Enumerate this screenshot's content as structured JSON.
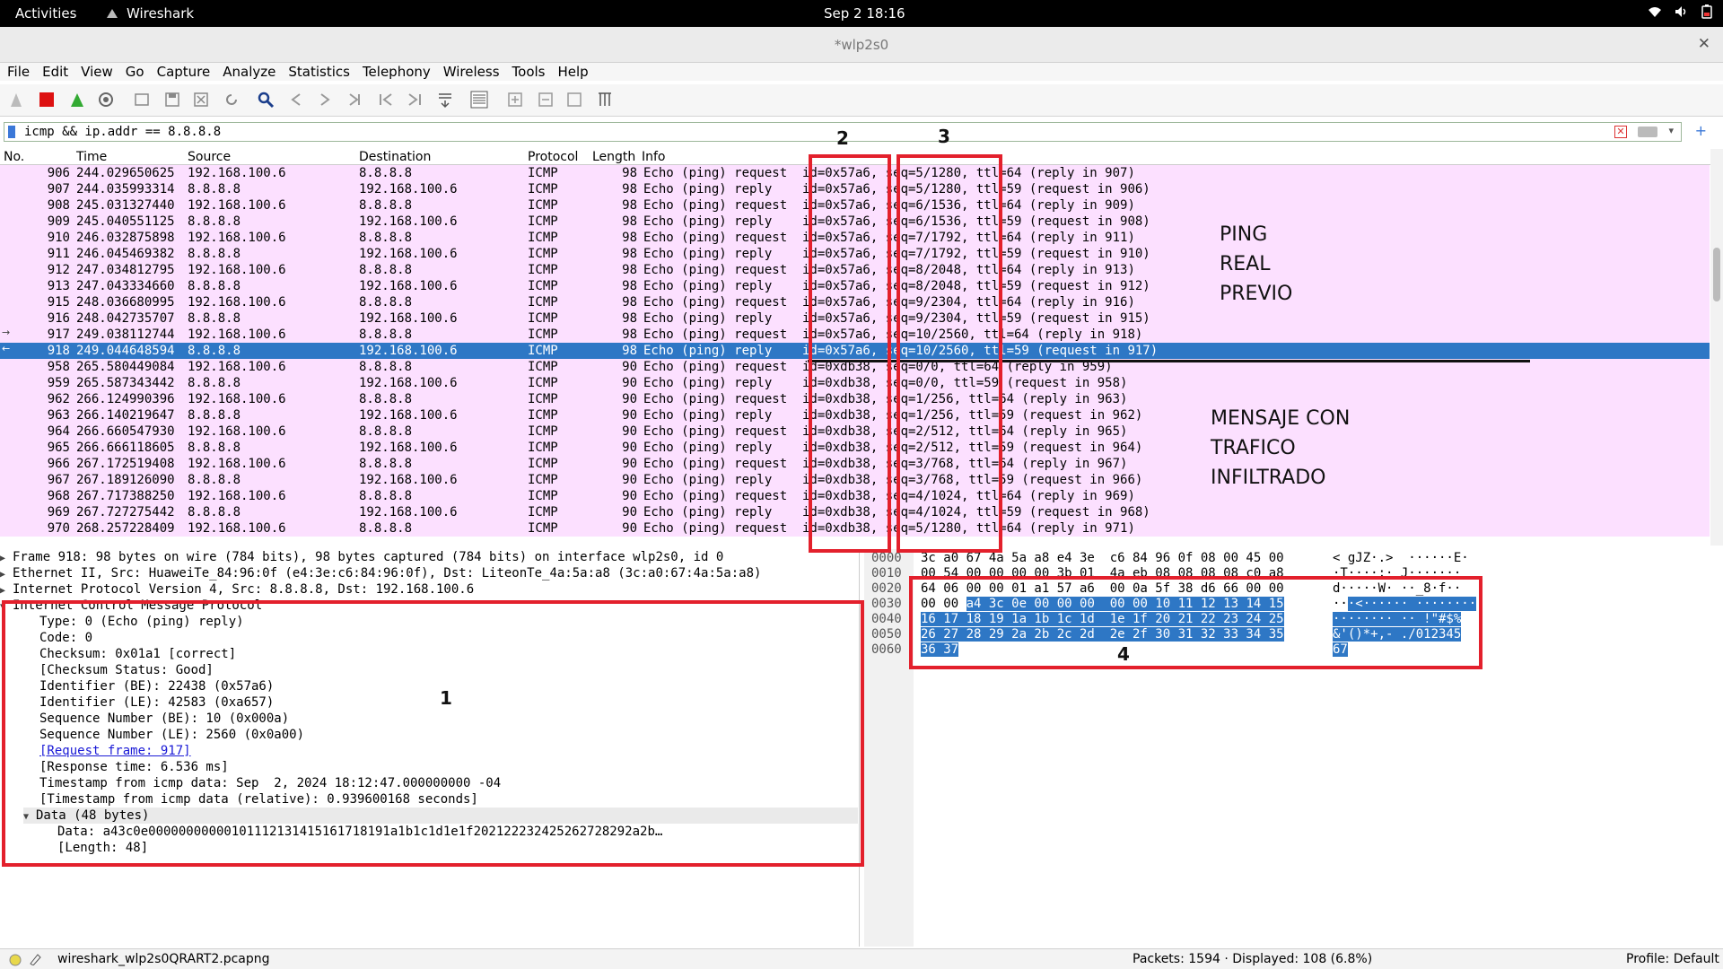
{
  "topbar": {
    "activities": "Activities",
    "app": "Wireshark",
    "clock": "Sep 2  18:16"
  },
  "window": {
    "title": "*wlp2s0"
  },
  "menu": [
    "File",
    "Edit",
    "View",
    "Go",
    "Capture",
    "Analyze",
    "Statistics",
    "Telephony",
    "Wireless",
    "Tools",
    "Help"
  ],
  "filter": {
    "text": "icmp && ip.addr == 8.8.8.8"
  },
  "packet_list": {
    "columns": {
      "no": "No.",
      "time": "Time",
      "source": "Source",
      "destination": "Destination",
      "protocol": "Protocol",
      "length": "Length",
      "info": "Info"
    },
    "rows": [
      {
        "no": "906",
        "time": "244.029650625",
        "src": "192.168.100.6",
        "dst": "8.8.8.8",
        "proto": "ICMP",
        "len": "98",
        "info": "Echo (ping) request  id=0x57a6, seq=5/1280, ttl=64 (reply in 907)"
      },
      {
        "no": "907",
        "time": "244.035993314",
        "src": "8.8.8.8",
        "dst": "192.168.100.6",
        "proto": "ICMP",
        "len": "98",
        "info": "Echo (ping) reply    id=0x57a6, seq=5/1280, ttl=59 (request in 906)"
      },
      {
        "no": "908",
        "time": "245.031327440",
        "src": "192.168.100.6",
        "dst": "8.8.8.8",
        "proto": "ICMP",
        "len": "98",
        "info": "Echo (ping) request  id=0x57a6, seq=6/1536, ttl=64 (reply in 909)"
      },
      {
        "no": "909",
        "time": "245.040551125",
        "src": "8.8.8.8",
        "dst": "192.168.100.6",
        "proto": "ICMP",
        "len": "98",
        "info": "Echo (ping) reply    id=0x57a6, seq=6/1536, ttl=59 (request in 908)"
      },
      {
        "no": "910",
        "time": "246.032875898",
        "src": "192.168.100.6",
        "dst": "8.8.8.8",
        "proto": "ICMP",
        "len": "98",
        "info": "Echo (ping) request  id=0x57a6, seq=7/1792, ttl=64 (reply in 911)"
      },
      {
        "no": "911",
        "time": "246.045469382",
        "src": "8.8.8.8",
        "dst": "192.168.100.6",
        "proto": "ICMP",
        "len": "98",
        "info": "Echo (ping) reply    id=0x57a6, seq=7/1792, ttl=59 (request in 910)"
      },
      {
        "no": "912",
        "time": "247.034812795",
        "src": "192.168.100.6",
        "dst": "8.8.8.8",
        "proto": "ICMP",
        "len": "98",
        "info": "Echo (ping) request  id=0x57a6, seq=8/2048, ttl=64 (reply in 913)"
      },
      {
        "no": "913",
        "time": "247.043334660",
        "src": "8.8.8.8",
        "dst": "192.168.100.6",
        "proto": "ICMP",
        "len": "98",
        "info": "Echo (ping) reply    id=0x57a6, seq=8/2048, ttl=59 (request in 912)"
      },
      {
        "no": "915",
        "time": "248.036680995",
        "src": "192.168.100.6",
        "dst": "8.8.8.8",
        "proto": "ICMP",
        "len": "98",
        "info": "Echo (ping) request  id=0x57a6, seq=9/2304, ttl=64 (reply in 916)"
      },
      {
        "no": "916",
        "time": "248.042735707",
        "src": "8.8.8.8",
        "dst": "192.168.100.6",
        "proto": "ICMP",
        "len": "98",
        "info": "Echo (ping) reply    id=0x57a6, seq=9/2304, ttl=59 (request in 915)"
      },
      {
        "no": "917",
        "time": "249.038112744",
        "src": "192.168.100.6",
        "dst": "8.8.8.8",
        "proto": "ICMP",
        "len": "98",
        "info": "Echo (ping) request  id=0x57a6, seq=10/2560, ttl=64 (reply in 918)"
      },
      {
        "no": "918",
        "time": "249.044648594",
        "src": "8.8.8.8",
        "dst": "192.168.100.6",
        "proto": "ICMP",
        "len": "98",
        "info": "Echo (ping) reply    id=0x57a6, seq=10/2560, ttl=59 (request in 917)"
      },
      {
        "no": "958",
        "time": "265.580449084",
        "src": "192.168.100.6",
        "dst": "8.8.8.8",
        "proto": "ICMP",
        "len": "90",
        "info": "Echo (ping) request  id=0xdb38, seq=0/0, ttl=64 (reply in 959)"
      },
      {
        "no": "959",
        "time": "265.587343442",
        "src": "8.8.8.8",
        "dst": "192.168.100.6",
        "proto": "ICMP",
        "len": "90",
        "info": "Echo (ping) reply    id=0xdb38, seq=0/0, ttl=59 (request in 958)"
      },
      {
        "no": "962",
        "time": "266.124990396",
        "src": "192.168.100.6",
        "dst": "8.8.8.8",
        "proto": "ICMP",
        "len": "90",
        "info": "Echo (ping) request  id=0xdb38, seq=1/256, ttl=64 (reply in 963)"
      },
      {
        "no": "963",
        "time": "266.140219647",
        "src": "8.8.8.8",
        "dst": "192.168.100.6",
        "proto": "ICMP",
        "len": "90",
        "info": "Echo (ping) reply    id=0xdb38, seq=1/256, ttl=59 (request in 962)"
      },
      {
        "no": "964",
        "time": "266.660547930",
        "src": "192.168.100.6",
        "dst": "8.8.8.8",
        "proto": "ICMP",
        "len": "90",
        "info": "Echo (ping) request  id=0xdb38, seq=2/512, ttl=64 (reply in 965)"
      },
      {
        "no": "965",
        "time": "266.666118605",
        "src": "8.8.8.8",
        "dst": "192.168.100.6",
        "proto": "ICMP",
        "len": "90",
        "info": "Echo (ping) reply    id=0xdb38, seq=2/512, ttl=59 (request in 964)"
      },
      {
        "no": "966",
        "time": "267.172519408",
        "src": "192.168.100.6",
        "dst": "8.8.8.8",
        "proto": "ICMP",
        "len": "90",
        "info": "Echo (ping) request  id=0xdb38, seq=3/768, ttl=64 (reply in 967)"
      },
      {
        "no": "967",
        "time": "267.189126090",
        "src": "8.8.8.8",
        "dst": "192.168.100.6",
        "proto": "ICMP",
        "len": "90",
        "info": "Echo (ping) reply    id=0xdb38, seq=3/768, ttl=59 (request in 966)"
      },
      {
        "no": "968",
        "time": "267.717388250",
        "src": "192.168.100.6",
        "dst": "8.8.8.8",
        "proto": "ICMP",
        "len": "90",
        "info": "Echo (ping) request  id=0xdb38, seq=4/1024, ttl=64 (reply in 969)"
      },
      {
        "no": "969",
        "time": "267.727275442",
        "src": "8.8.8.8",
        "dst": "192.168.100.6",
        "proto": "ICMP",
        "len": "90",
        "info": "Echo (ping) reply    id=0xdb38, seq=4/1024, ttl=59 (request in 968)"
      },
      {
        "no": "970",
        "time": "268.257228409",
        "src": "192.168.100.6",
        "dst": "8.8.8.8",
        "proto": "ICMP",
        "len": "90",
        "info": "Echo (ping) request  id=0xdb38, seq=5/1280, ttl=64 (reply in 971)"
      }
    ],
    "selected_no": "918",
    "colors": {
      "row_bg": "#fce0ff",
      "selected_bg": "#2e77c5"
    }
  },
  "details": {
    "frame": "Frame 918: 98 bytes on wire (784 bits), 98 bytes captured (784 bits) on interface wlp2s0, id 0",
    "ethernet": "Ethernet II, Src: HuaweiTe_84:96:0f (e4:3e:c6:84:96:0f), Dst: LiteonTe_4a:5a:a8 (3c:a0:67:4a:5a:a8)",
    "ip": "Internet Protocol Version 4, Src: 8.8.8.8, Dst: 192.168.100.6",
    "icmp": "Internet Control Message Protocol",
    "fields": {
      "type": "Type: 0 (Echo (ping) reply)",
      "code": "Code: 0",
      "checksum": "Checksum: 0x01a1 [correct]",
      "checksum_status": "[Checksum Status: Good]",
      "id_be": "Identifier (BE): 22438 (0x57a6)",
      "id_le": "Identifier (LE): 42583 (0xa657)",
      "seq_be": "Sequence Number (BE): 10 (0x000a)",
      "seq_le": "Sequence Number (LE): 2560 (0x0a00)",
      "request_frame": "[Request frame: 917]",
      "response_time": "[Response time: 6.536 ms]",
      "timestamp": "Timestamp from icmp data: Sep  2, 2024 18:12:47.000000000 -04",
      "timestamp_rel": "[Timestamp from icmp data (relative): 0.939600168 seconds]",
      "data_header": "Data (48 bytes)",
      "data": "Data: a43c0e00000000000101112131415161718191a1b1c1d1e1f202122232425262728292a2b…",
      "length": "[Length: 48]"
    }
  },
  "bytes": {
    "lines": [
      {
        "off": "0000",
        "hex": "3c a0 67 4a 5a a8 e4 3e  c6 84 96 0f 08 00 45 00",
        "ascii": "< gJZ·.>  ······E·"
      },
      {
        "off": "0010",
        "hex": "00 54 00 00 00 00 3b 01  4a eb 08 08 08 08 c0 a8",
        "ascii": "·T····;· J·······"
      },
      {
        "off": "0020",
        "hex": "64 06 00 00 01 a1 57 a6  00 0a 5f 38 d6 66 00 00",
        "ascii": "d·····W· ··_8·f··"
      },
      {
        "off": "0030",
        "hex_plain": "00 00 ",
        "hex_hl": "a4 3c 0e 00 00 00  00 00 10 11 12 13 14 15",
        "ascii_plain": "··",
        "ascii_hl": "·<······ ········"
      },
      {
        "off": "0040",
        "hex_hl": "16 17 18 19 1a 1b 1c 1d  1e 1f 20 21 22 23 24 25",
        "ascii_hl": "········ ·· !\"#$%"
      },
      {
        "off": "0050",
        "hex_hl": "26 27 28 29 2a 2b 2c 2d  2e 2f 30 31 32 33 34 35",
        "ascii_hl": "&'()*+,- ./012345"
      },
      {
        "off": "0060",
        "hex_hl": "36 37",
        "ascii_hl": "67"
      }
    ]
  },
  "status": {
    "file": "wireshark_wlp2s0QRART2.pcapng",
    "packets": "Packets: 1594 · Displayed: 108 (6.8%)",
    "profile": "Profile: Default"
  },
  "annotations": {
    "label_1": "1",
    "label_2": "2",
    "label_3": "3",
    "label_4": "4",
    "ping_real": [
      "PING",
      "REAL",
      "PREVIO"
    ],
    "infiltrado": [
      "MENSAJE CON",
      "TRAFICO",
      "INFILTRADO"
    ],
    "color": "#e3202c"
  }
}
